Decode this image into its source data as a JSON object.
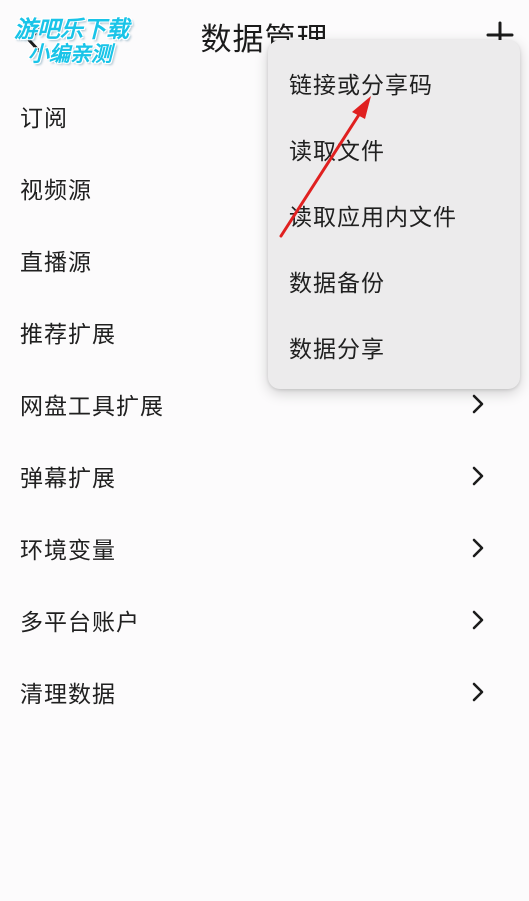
{
  "header": {
    "title": "数据管理",
    "back_icon": "chevron-left-icon",
    "add_icon": "plus-icon"
  },
  "watermark": {
    "line1": "游吧乐下载",
    "line2": "小编亲测",
    "color": "#19c4e8"
  },
  "list": {
    "items": [
      {
        "label": "订阅"
      },
      {
        "label": "视频源"
      },
      {
        "label": "直播源"
      },
      {
        "label": "推荐扩展"
      },
      {
        "label": "网盘工具扩展"
      },
      {
        "label": "弹幕扩展"
      },
      {
        "label": "环境变量"
      },
      {
        "label": "多平台账户"
      },
      {
        "label": "清理数据"
      }
    ]
  },
  "popup": {
    "items": [
      {
        "label": "链接或分享码"
      },
      {
        "label": "读取文件"
      },
      {
        "label": "读取应用内文件"
      },
      {
        "label": "数据备份"
      },
      {
        "label": "数据分享"
      }
    ]
  },
  "annotation": {
    "arrow_color": "#e02020"
  }
}
